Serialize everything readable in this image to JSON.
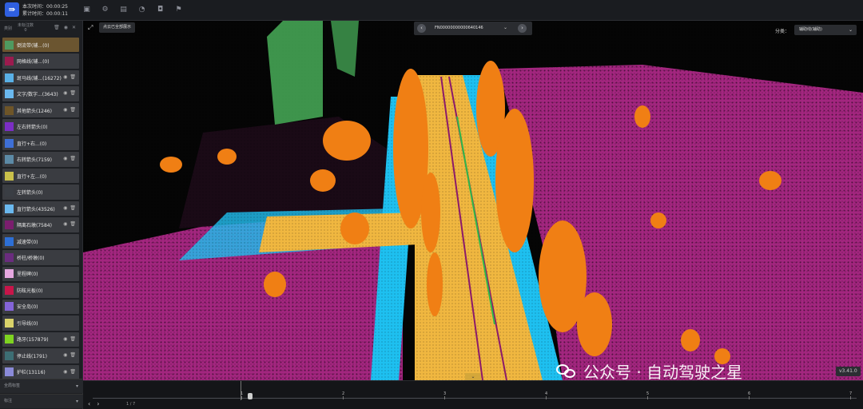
{
  "topbar": {
    "logo_glyph": "⇛",
    "time_this_label": "本次时间：00:00:25",
    "time_total_label": "累计时间：00:00:11",
    "tools": [
      "save-icon",
      "settings-icon",
      "image-icon",
      "refresh-icon",
      "tag-icon",
      "flag-icon"
    ]
  },
  "left_panel": {
    "header_left": "类别",
    "header_mid_top": "未标注数",
    "header_mid_bottom": "0",
    "classes": [
      {
        "label": "倒流带(辅...(0)",
        "color": "#4f9a60",
        "selected": true,
        "icons": false
      },
      {
        "label": "网格线(辅...(0)",
        "color": "#9b1b4e",
        "icons": false
      },
      {
        "label": "斑马线(辅...(16272)",
        "color": "#59b0e6",
        "icons": true
      },
      {
        "label": "文字/数字...(3643)",
        "color": "#6ab8ee",
        "icons": true
      },
      {
        "label": "其他箭头(1246)",
        "color": "#6e5528",
        "icons": true
      },
      {
        "label": "左右转箭头(0)",
        "color": "#7b2ec4",
        "icons": false
      },
      {
        "label": "直行+右...(0)",
        "color": "#3e6fd6",
        "icons": false
      },
      {
        "label": "右转箭头(7159)",
        "color": "#5c8aa6",
        "icons": true
      },
      {
        "label": "直行+左...(0)",
        "color": "#c9c04a",
        "icons": false
      },
      {
        "label": "左转箭头(0)",
        "color": "#3a3e44",
        "icons": false
      },
      {
        "label": "直行箭头(43526)",
        "color": "#6ab8ee",
        "icons": true
      },
      {
        "label": "隔离石墩(7584)",
        "color": "#7b1e6e",
        "icons": true
      },
      {
        "label": "减速带(0)",
        "color": "#2d6fd6",
        "icons": false
      },
      {
        "label": "桥柱/桥墩(0)",
        "color": "#6a2c7e",
        "icons": false
      },
      {
        "label": "里程碑(0)",
        "color": "#e6a8e0",
        "icons": false
      },
      {
        "label": "防眩光板(0)",
        "color": "#c8154a",
        "icons": false
      },
      {
        "label": "安全岛(0)",
        "color": "#8464d8",
        "icons": false
      },
      {
        "label": "引导线(0)",
        "color": "#d9d26a",
        "icons": false
      },
      {
        "label": "路牙(157879)",
        "color": "#7ed321",
        "icons": true
      },
      {
        "label": "停止线(1791)",
        "color": "#3d6e74",
        "icons": true
      },
      {
        "label": "护栏(13116)",
        "color": "#8a8ad8",
        "icons": true
      }
    ],
    "section_global_tags": "全局标签",
    "section_annotations": "标注"
  },
  "viewport": {
    "show_all_label": "点云已全部展示",
    "frame_id": "FN0000000000064014​6",
    "category_label": "分类：",
    "category_value": "辅助线(辅助)",
    "version": "v3.41.0",
    "watermark": "公众号 · 自动驾驶之星",
    "colors": {
      "road": "#f0b740",
      "trees": "#f07f14",
      "ground": "#a3267f",
      "curb": "#1ec0f0",
      "buildings": "#4cb85e"
    }
  },
  "timeline": {
    "page": "1 / 7",
    "ticks": [
      "1",
      "2",
      "3",
      "4",
      "5",
      "6",
      "7"
    ],
    "current_fraction": 0.0
  }
}
